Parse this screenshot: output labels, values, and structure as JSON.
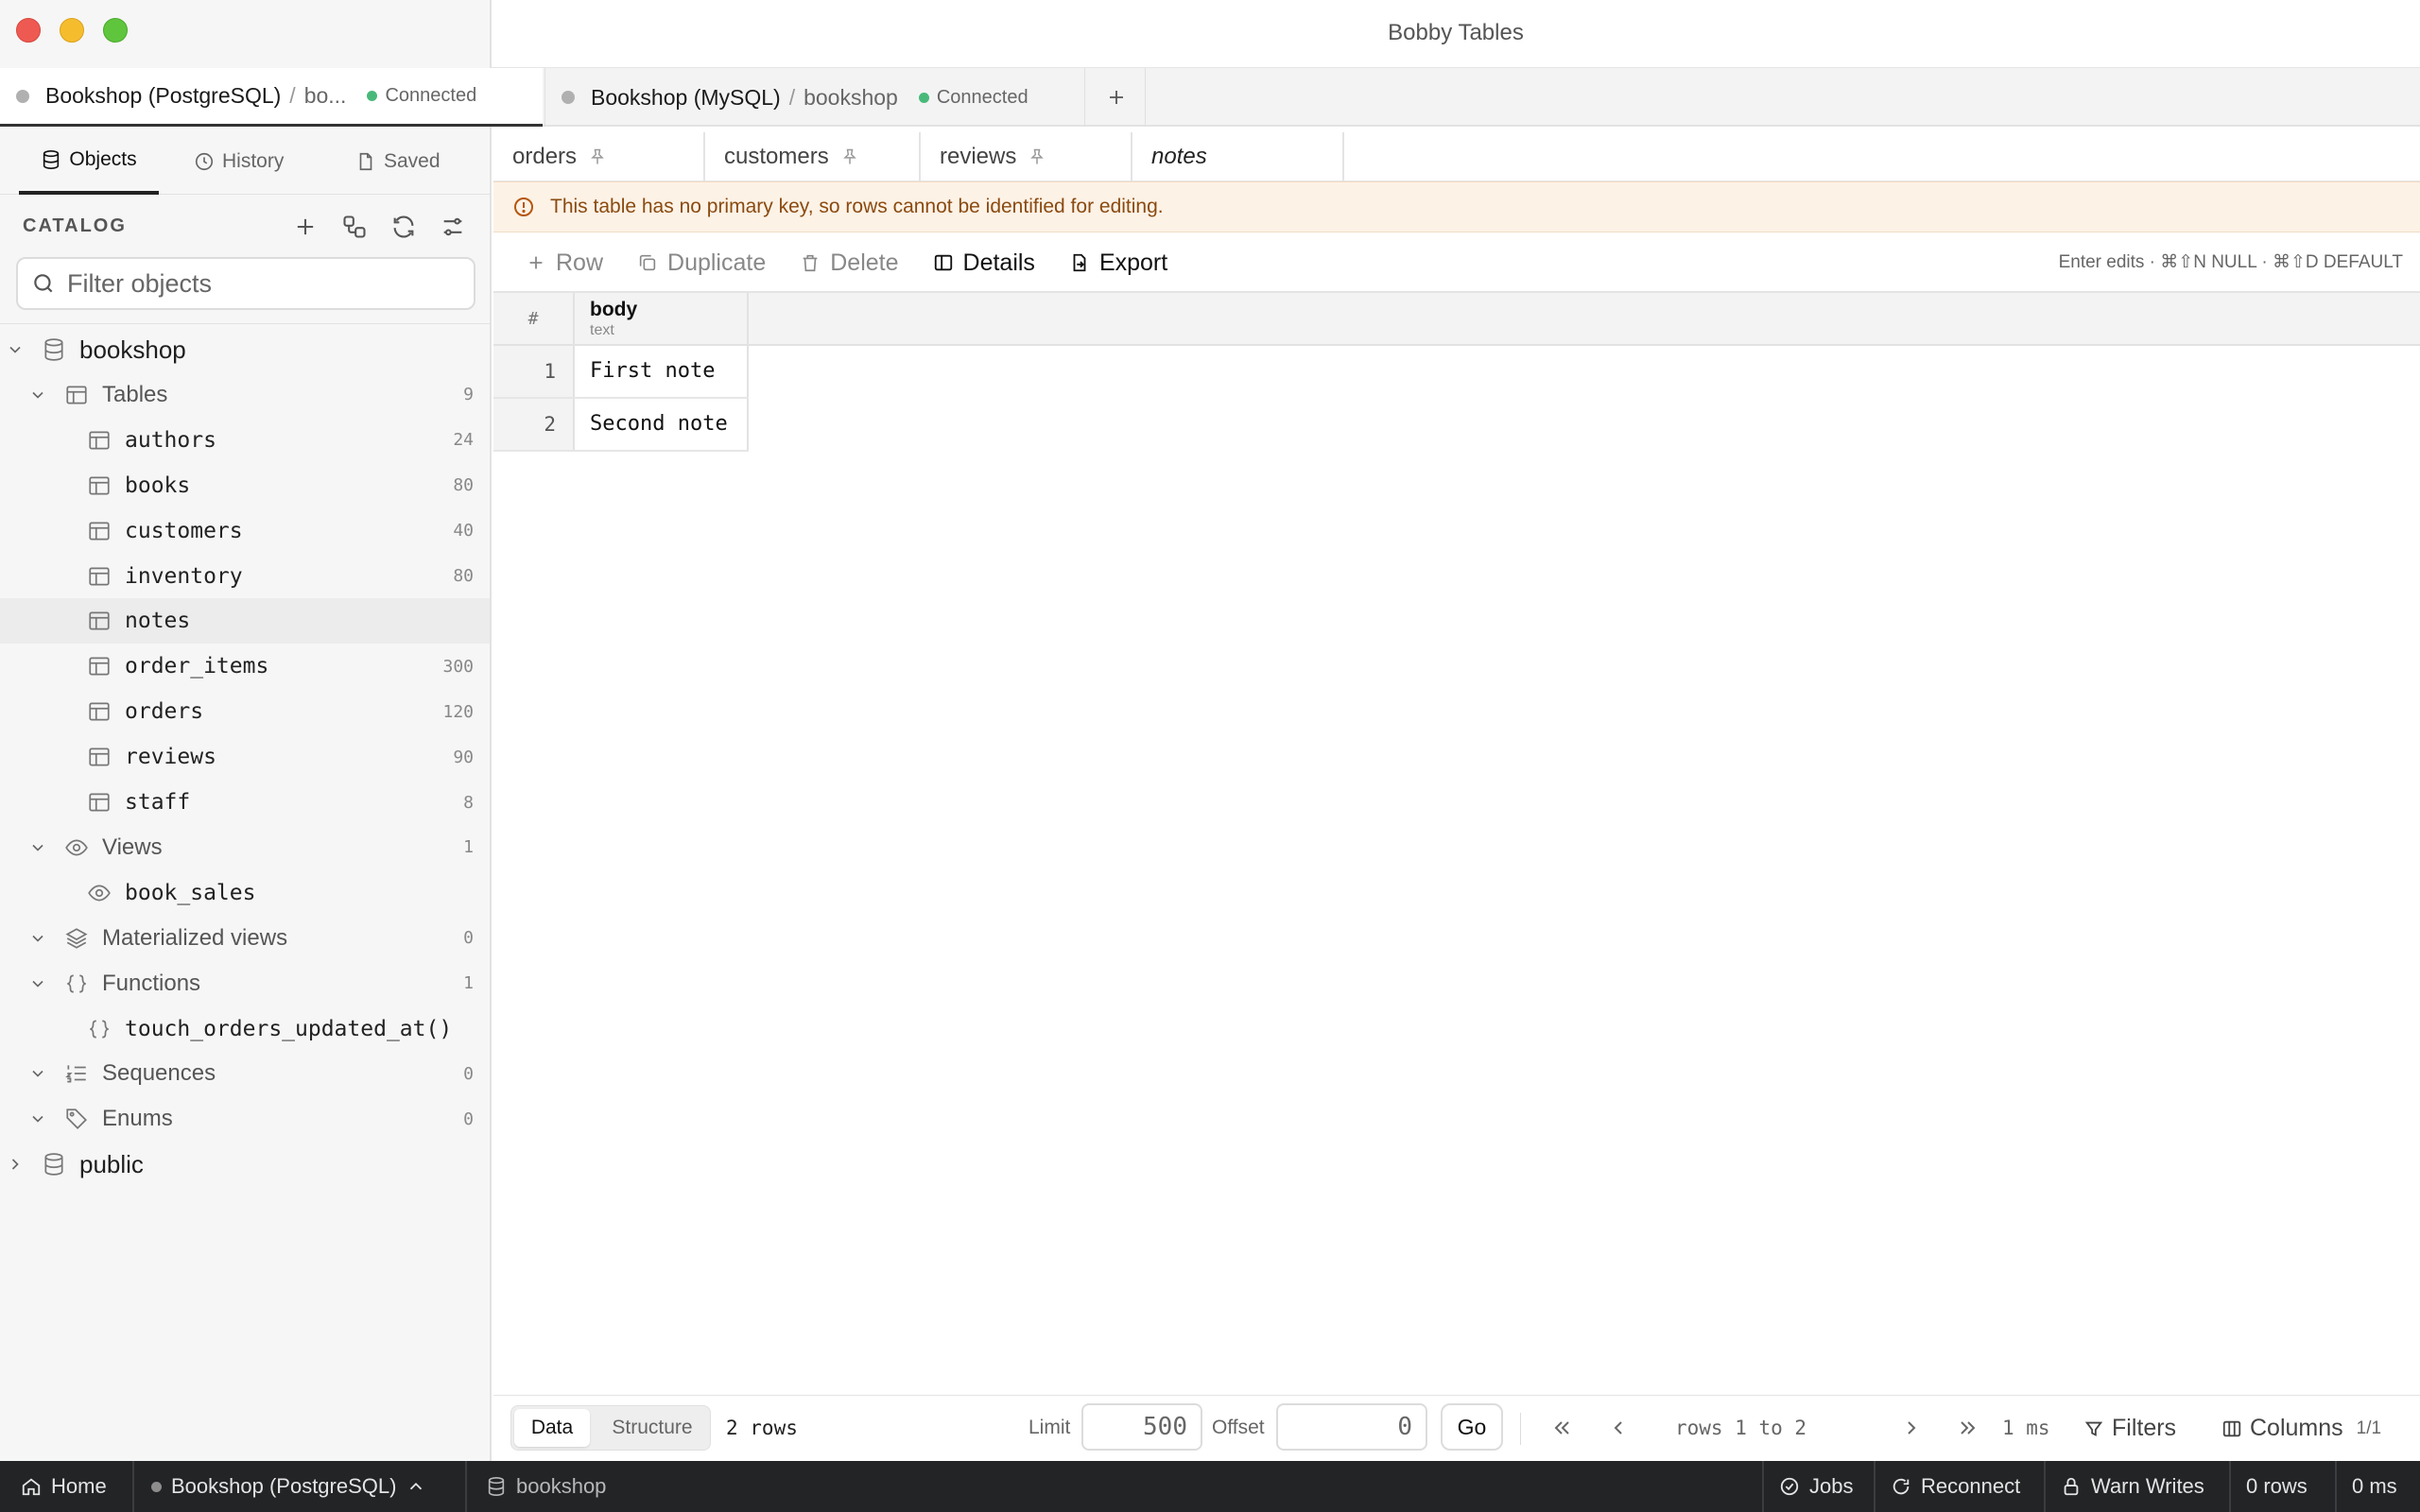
{
  "window": {
    "title": "Bobby Tables"
  },
  "connections": {
    "tabs": [
      {
        "name": "Bookshop (PostgreSQL)",
        "sep": "/",
        "db": "bo...",
        "status": "Connected"
      },
      {
        "name": "Bookshop (MySQL)",
        "sep": "/",
        "db": "bookshop",
        "status": "Connected"
      }
    ],
    "add_label": "+"
  },
  "sidebar": {
    "tabs": [
      {
        "label": "Objects",
        "icon": "database-icon"
      },
      {
        "label": "History",
        "icon": "clock-icon"
      },
      {
        "label": "Saved",
        "icon": "document-icon"
      }
    ],
    "catalog_label": "CATALOG",
    "filter_placeholder": "Filter objects",
    "tree": [
      {
        "label": "bookshop",
        "kind": "database",
        "count": ""
      },
      {
        "label": "Tables",
        "kind": "group",
        "count": "9"
      },
      {
        "label": "authors",
        "kind": "table",
        "count": "24"
      },
      {
        "label": "books",
        "kind": "table",
        "count": "80"
      },
      {
        "label": "customers",
        "kind": "table",
        "count": "40"
      },
      {
        "label": "inventory",
        "kind": "table",
        "count": "80"
      },
      {
        "label": "notes",
        "kind": "table",
        "count": ""
      },
      {
        "label": "order_items",
        "kind": "table",
        "count": "300"
      },
      {
        "label": "orders",
        "kind": "table",
        "count": "120"
      },
      {
        "label": "reviews",
        "kind": "table",
        "count": "90"
      },
      {
        "label": "staff",
        "kind": "table",
        "count": "8"
      },
      {
        "label": "Views",
        "kind": "group",
        "count": "1"
      },
      {
        "label": "book_sales",
        "kind": "view",
        "count": ""
      },
      {
        "label": "Materialized views",
        "kind": "group",
        "count": "0"
      },
      {
        "label": "Functions",
        "kind": "group",
        "count": "1"
      },
      {
        "label": "touch_orders_updated_at()",
        "kind": "function",
        "count": ""
      },
      {
        "label": "Sequences",
        "kind": "group",
        "count": "0"
      },
      {
        "label": "Enums",
        "kind": "group",
        "count": "0"
      },
      {
        "label": "public",
        "kind": "database",
        "count": ""
      }
    ],
    "selected_item": "notes"
  },
  "table_tabs": [
    {
      "label": "orders",
      "pinned": true
    },
    {
      "label": "customers",
      "pinned": true
    },
    {
      "label": "reviews",
      "pinned": true
    },
    {
      "label": "notes",
      "pinned": false
    }
  ],
  "warning": {
    "text": "This table has no primary key, so rows cannot be identified for editing."
  },
  "toolbar": {
    "row_label": "Row",
    "duplicate_label": "Duplicate",
    "delete_label": "Delete",
    "details_label": "Details",
    "export_label": "Export",
    "hint": "Enter edits · ⌘⇧N NULL · ⌘⇧D DEFAULT"
  },
  "grid": {
    "rownum_header": "#",
    "columns": [
      {
        "name": "body",
        "type": "text"
      }
    ],
    "rows": [
      {
        "num": "1",
        "body": "First note"
      },
      {
        "num": "2",
        "body": "Second note"
      }
    ]
  },
  "pager": {
    "data_label": "Data",
    "structure_label": "Structure",
    "row_count": "2 rows",
    "limit_label": "Limit",
    "limit_value": "500",
    "offset_label": "Offset",
    "offset_value": "0",
    "go_label": "Go",
    "range": "rows 1 to 2",
    "time": "1 ms",
    "filters_label": "Filters",
    "columns_label": "Columns",
    "columns_count": "1/1"
  },
  "statusbar": {
    "home_label": "Home",
    "connection_label": "Bookshop (PostgreSQL)",
    "database_label": "bookshop",
    "jobs_label": "Jobs",
    "reconnect_label": "Reconnect",
    "warn_writes_label": "Warn Writes",
    "rows_label": "0 rows",
    "time_label": "0 ms"
  }
}
